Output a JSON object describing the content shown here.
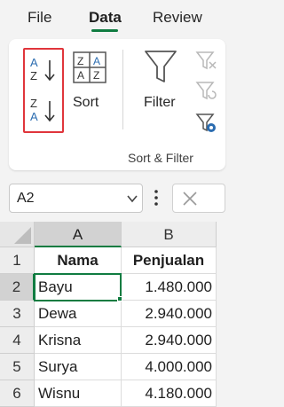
{
  "menu": {
    "tabs": [
      {
        "label": "File"
      },
      {
        "label": "Data",
        "active": true
      },
      {
        "label": "Review"
      }
    ]
  },
  "ribbon": {
    "sort_az_icon": "sort-a-to-z-icon",
    "sort_za_icon": "sort-z-to-a-icon",
    "sort_label": "Sort",
    "filter_label": "Filter",
    "group_label": "Sort & Filter",
    "highlight_color": "#e0353b"
  },
  "formula_bar": {
    "name_box_value": "A2"
  },
  "sheet": {
    "columns": [
      "A",
      "B"
    ],
    "rows": [
      "1",
      "2",
      "3",
      "4",
      "5",
      "6"
    ],
    "header": [
      "Nama",
      "Penjualan"
    ],
    "data": [
      [
        "Bayu",
        "1.480.000"
      ],
      [
        "Dewa",
        "2.940.000"
      ],
      [
        "Krisna",
        "2.940.000"
      ],
      [
        "Surya",
        "4.000.000"
      ],
      [
        "Wisnu",
        "4.180.000"
      ]
    ],
    "active_cell": "A2",
    "accent_color": "#107c41"
  }
}
